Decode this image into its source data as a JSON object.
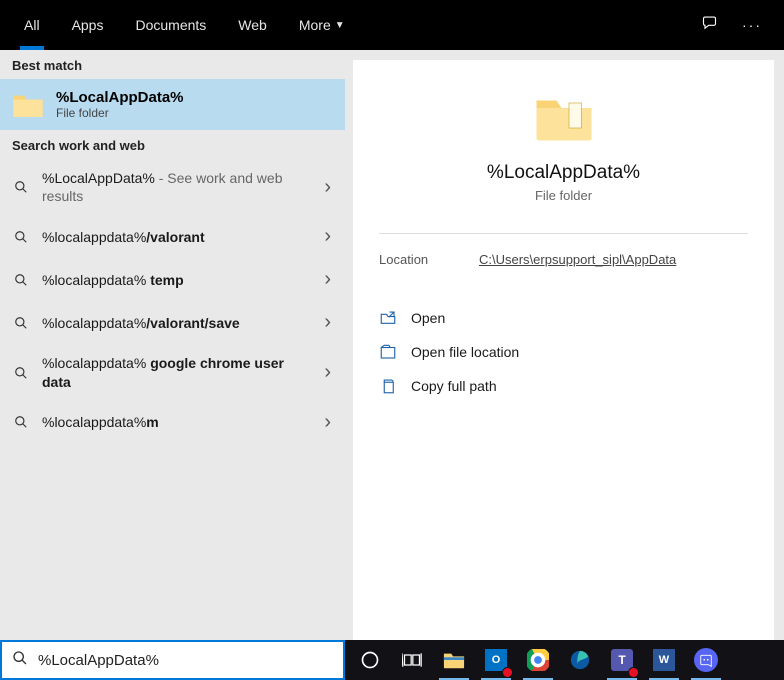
{
  "tabs": {
    "all": "All",
    "apps": "Apps",
    "documents": "Documents",
    "web": "Web",
    "more": "More"
  },
  "sections": {
    "best_match": "Best match",
    "search_work_web": "Search work and web"
  },
  "best_match": {
    "title": "%LocalAppData%",
    "subtitle": "File folder"
  },
  "results": [
    {
      "prefix": "%LocalAppData%",
      "suffix": "",
      "trailing": " - See work and web results"
    },
    {
      "prefix": "%localappdata%",
      "suffix": "/valorant",
      "trailing": ""
    },
    {
      "prefix": "%localappdata% ",
      "suffix": "temp",
      "trailing": ""
    },
    {
      "prefix": "%localappdata%",
      "suffix": "/valorant/save",
      "trailing": ""
    },
    {
      "prefix": "%localappdata% ",
      "suffix": "google chrome user data",
      "trailing": ""
    },
    {
      "prefix": "%localappdata%",
      "suffix": "m",
      "trailing": ""
    }
  ],
  "detail": {
    "title": "%LocalAppData%",
    "subtitle": "File folder",
    "location_label": "Location",
    "location_value": "C:\\Users\\erpsupport_sipl\\AppData",
    "actions": {
      "open": "Open",
      "open_location": "Open file location",
      "copy_path": "Copy full path"
    }
  },
  "search": {
    "value": "%LocalAppData%"
  }
}
